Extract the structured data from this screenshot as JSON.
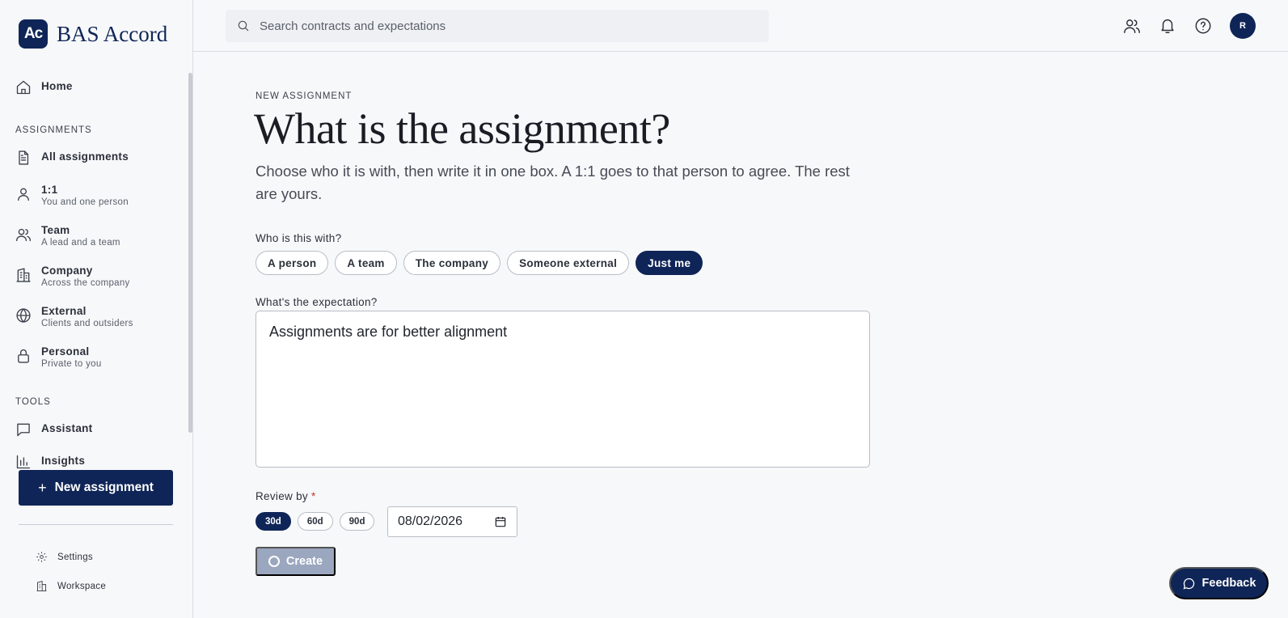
{
  "brand": {
    "mark": "Ac",
    "name": "BAS Accord"
  },
  "search": {
    "placeholder": "Search contracts and expectations"
  },
  "avatar": {
    "initial": "R"
  },
  "sidebar": {
    "home": "Home",
    "assignments_section": "ASSIGNMENTS",
    "items": [
      {
        "label": "All assignments",
        "sub": ""
      },
      {
        "label": "1:1",
        "sub": "You and one person"
      },
      {
        "label": "Team",
        "sub": "A lead and a team"
      },
      {
        "label": "Company",
        "sub": "Across the company"
      },
      {
        "label": "External",
        "sub": "Clients and outsiders"
      },
      {
        "label": "Personal",
        "sub": "Private to you"
      }
    ],
    "tools_section": "TOOLS",
    "tools": [
      {
        "label": "Assistant"
      },
      {
        "label": "Insights"
      }
    ],
    "new_button": "New assignment",
    "footer": [
      {
        "label": "Settings"
      },
      {
        "label": "Workspace"
      }
    ]
  },
  "main": {
    "eyebrow": "NEW ASSIGNMENT",
    "title": "What is the assignment?",
    "subtitle": "Choose who it is with, then write it in one box. A 1:1 goes to that person to agree. The rest are yours.",
    "with_label": "Who is this with?",
    "with_options": [
      "A person",
      "A team",
      "The company",
      "Someone external",
      "Just me"
    ],
    "with_selected": "Just me",
    "expectation_label": "What's the expectation?",
    "expectation_value": "Assignments are for better alignment",
    "review_label": "Review by",
    "review_required": "*",
    "review_options": [
      "30d",
      "60d",
      "90d"
    ],
    "review_selected": "30d",
    "review_date": "08/02/2026",
    "create_button": "Create"
  },
  "feedback_button": "Feedback",
  "colors": {
    "brand": "#0f2557",
    "disabled": "#9ba7bf",
    "required": "#c0392b"
  }
}
